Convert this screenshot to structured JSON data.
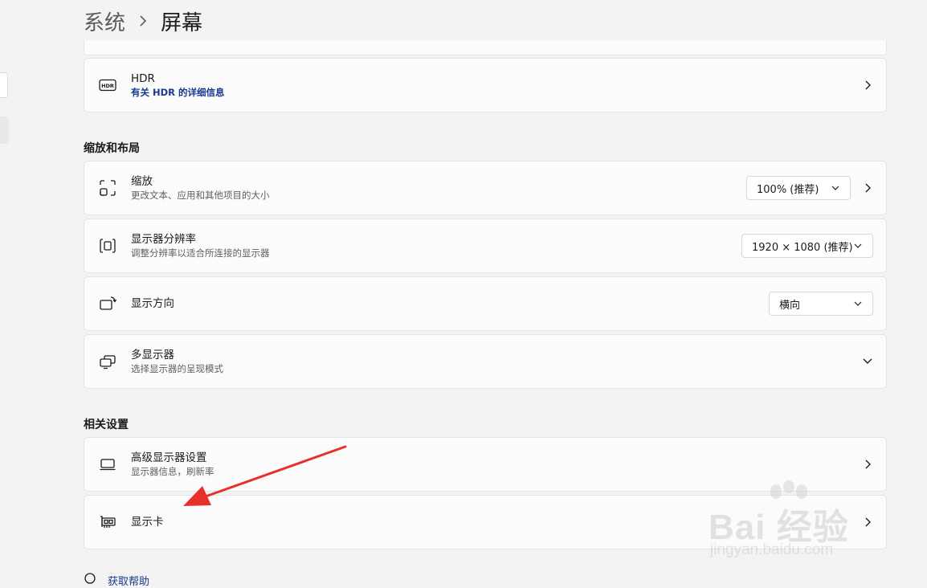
{
  "breadcrumb": {
    "parent": "系统",
    "current": "屏幕"
  },
  "hdr": {
    "title": "HDR",
    "link": "有关 HDR 的详细信息",
    "icon": "hdr-icon"
  },
  "sections": {
    "scale_layout": "缩放和布局",
    "related": "相关设置"
  },
  "scale": {
    "title": "缩放",
    "subtitle": "更改文本、应用和其他项目的大小",
    "value": "100% (推荐)",
    "icon": "scale-icon"
  },
  "resolution": {
    "title": "显示器分辨率",
    "subtitle": "调整分辨率以适合所连接的显示器",
    "value": "1920 × 1080 (推荐)",
    "icon": "resolution-icon"
  },
  "orientation": {
    "title": "显示方向",
    "value": "横向",
    "icon": "orientation-icon"
  },
  "multi_display": {
    "title": "多显示器",
    "subtitle": "选择显示器的呈现模式",
    "icon": "multi-display-icon"
  },
  "advanced_display": {
    "title": "高级显示器设置",
    "subtitle": "显示器信息，刷新率",
    "icon": "monitor-icon"
  },
  "graphics": {
    "title": "显示卡",
    "icon": "graphics-card-icon"
  },
  "help": {
    "label": "获取帮助"
  },
  "watermark": {
    "brand": "Bai  经验",
    "url": "jingyan.baidu.com"
  },
  "colors": {
    "background": "#f3f3f3",
    "card": "#fbfbfb",
    "link": "#1a3a8f",
    "annotation_arrow": "#e8302a"
  }
}
